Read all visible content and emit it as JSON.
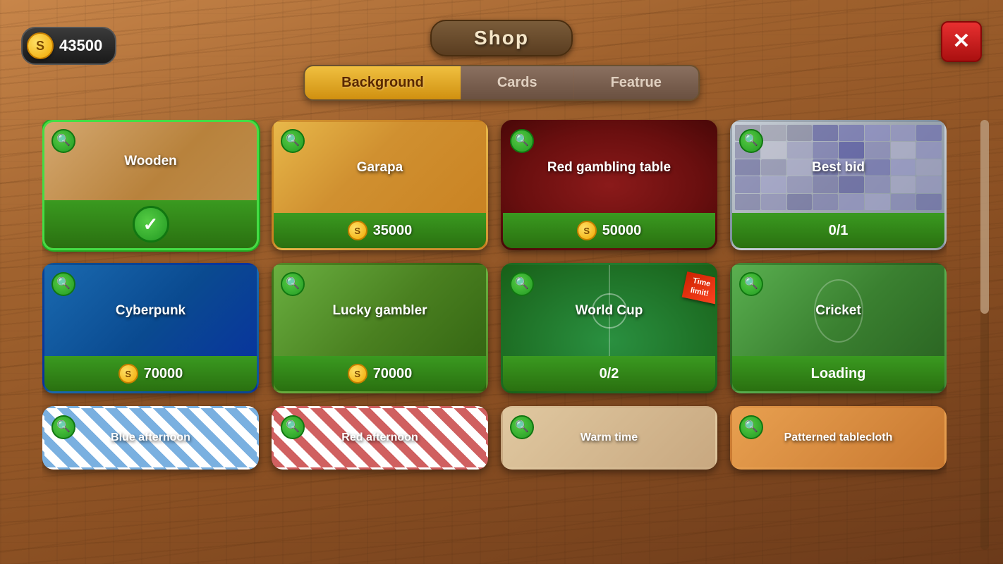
{
  "header": {
    "title": "Shop",
    "coin_amount": "43500",
    "coin_symbol": "S"
  },
  "close_button": {
    "label": "✕"
  },
  "tabs": [
    {
      "id": "background",
      "label": "Background",
      "active": true
    },
    {
      "id": "cards",
      "label": "Cards",
      "active": false
    },
    {
      "id": "featrue",
      "label": "Featrue",
      "active": false
    }
  ],
  "items": [
    {
      "id": "wooden",
      "name": "Wooden",
      "bg": "wooden",
      "status": "selected",
      "footer_type": "checkmark"
    },
    {
      "id": "garapa",
      "name": "Garapa",
      "bg": "garapa",
      "footer_type": "price",
      "price": "35000"
    },
    {
      "id": "red-gambling-table",
      "name": "Red gambling table",
      "bg": "red-table",
      "footer_type": "price",
      "price": "50000"
    },
    {
      "id": "best-bid",
      "name": "Best bid",
      "bg": "best-bid",
      "footer_type": "counter",
      "counter": "0/1"
    },
    {
      "id": "cyberpunk",
      "name": "Cyberpunk",
      "bg": "cyberpunk",
      "footer_type": "price",
      "price": "70000"
    },
    {
      "id": "lucky-gambler",
      "name": "Lucky gambler",
      "bg": "lucky",
      "footer_type": "price",
      "price": "70000"
    },
    {
      "id": "world-cup",
      "name": "World Cup",
      "bg": "worldcup",
      "footer_type": "counter",
      "counter": "0/2",
      "time_limit": true,
      "time_limit_text": "Time\nlimit!"
    },
    {
      "id": "cricket",
      "name": "Cricket",
      "bg": "cricket",
      "footer_type": "loading",
      "loading_text": "Loading"
    },
    {
      "id": "blue-afternoon",
      "name": "Blue afternoon",
      "bg": "blue-afternoon",
      "footer_type": "partial"
    },
    {
      "id": "red-afternoon",
      "name": "Red afternoon",
      "bg": "red-afternoon",
      "footer_type": "partial"
    },
    {
      "id": "warm-time",
      "name": "Warm time",
      "bg": "warm-time",
      "footer_type": "partial"
    },
    {
      "id": "patterned-tablecloth",
      "name": "Patterned tablecloth",
      "bg": "patterned",
      "footer_type": "partial"
    }
  ],
  "magnify_symbol": "🔍",
  "check_symbol": "✓",
  "coin_symbol": "S"
}
